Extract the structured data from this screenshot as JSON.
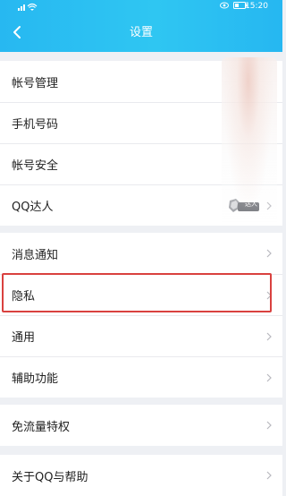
{
  "status_bar": {
    "time": "15:20",
    "signal_icon": "signal-wifi-icon",
    "eye_icon": "eye-icon",
    "battery_icon": "battery-icon"
  },
  "header": {
    "title": "设置",
    "back_icon": "chevron-left-icon"
  },
  "account_group": {
    "items": [
      {
        "label": "帐号管理"
      },
      {
        "label": "手机号码"
      },
      {
        "label": "帐号安全"
      },
      {
        "label": "QQ达人",
        "badge": "达人"
      }
    ]
  },
  "general_group": {
    "items": [
      {
        "label": "消息通知"
      },
      {
        "label": "隐私"
      },
      {
        "label": "通用"
      },
      {
        "label": "辅助功能"
      }
    ]
  },
  "privilege_group": {
    "items": [
      {
        "label": "免流量特权"
      }
    ]
  },
  "about_group": {
    "items": [
      {
        "label": "关于QQ与帮助"
      }
    ]
  },
  "colors": {
    "header": "#2ab9f2",
    "background": "#eef0f4",
    "highlight": "#d9413f",
    "chevron": "#b8b8be"
  }
}
